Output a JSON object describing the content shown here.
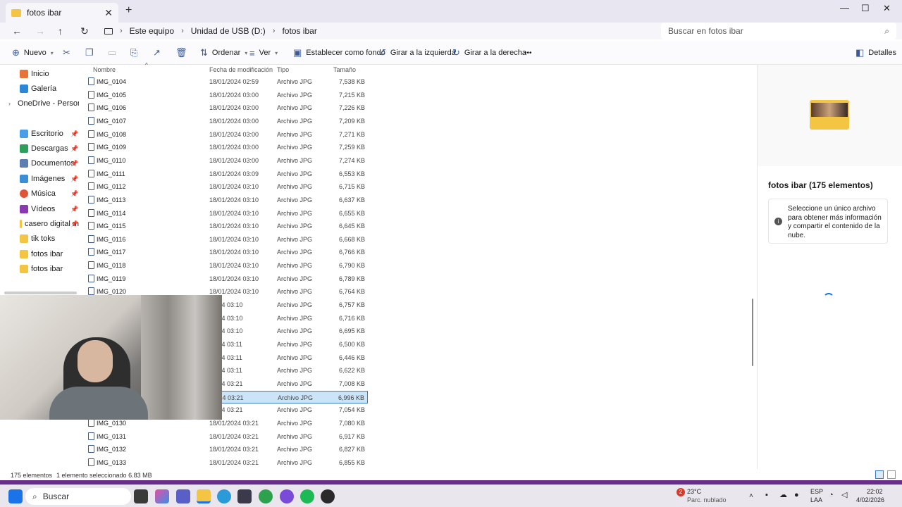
{
  "window": {
    "tab_title": "fotos ibar",
    "close": "✕",
    "new_tab": "+",
    "minimize": "—",
    "maximize": "☐",
    "close_window": "✕"
  },
  "address": {
    "breadcrumb": [
      "Este equipo",
      "Unidad de USB (D:)",
      "fotos ibar"
    ],
    "search_placeholder": "Buscar en fotos ibar"
  },
  "toolbar": {
    "new": "Nuevo",
    "sort": "Ordenar",
    "view": "Ver",
    "set_background": "Establecer como fondo",
    "rotate_left": "Girar a la izquierda",
    "rotate_right": "Girar a la derecha",
    "more": "•••",
    "details": "Detalles"
  },
  "sidebar": {
    "items": [
      {
        "label": "Inicio",
        "color": "#e8733a"
      },
      {
        "label": "Galería",
        "color": "#2b88d8"
      },
      {
        "label": "OneDrive - Persona",
        "color": "#2b88d8"
      },
      {
        "label": "Escritorio",
        "color": "#4a9ee8"
      },
      {
        "label": "Descargas",
        "color": "#2e9e5b"
      },
      {
        "label": "Documentos",
        "color": "#5a7fb0"
      },
      {
        "label": "Imágenes",
        "color": "#3a8fd8"
      },
      {
        "label": "Música",
        "color": "#e0543a"
      },
      {
        "label": "Vídeos",
        "color": "#8a3ab0"
      },
      {
        "label": "casero digital m",
        "color": "#f4c542"
      },
      {
        "label": "tik toks",
        "color": "#f4c542"
      },
      {
        "label": "fotos ibar",
        "color": "#f4c542"
      },
      {
        "label": "fotos ibar",
        "color": "#f4c542"
      }
    ]
  },
  "columns": {
    "name": "Nombre",
    "date": "Fecha de modificación",
    "type": "Tipo",
    "size": "Tamaño"
  },
  "files": [
    {
      "name": "IMG_0104",
      "date": "18/01/2024 02:59",
      "type": "Archivo JPG",
      "size": "7,538 KB"
    },
    {
      "name": "IMG_0105",
      "date": "18/01/2024 03:00",
      "type": "Archivo JPG",
      "size": "7,215 KB"
    },
    {
      "name": "IMG_0106",
      "date": "18/01/2024 03:00",
      "type": "Archivo JPG",
      "size": "7,226 KB"
    },
    {
      "name": "IMG_0107",
      "date": "18/01/2024 03:00",
      "type": "Archivo JPG",
      "size": "7,209 KB"
    },
    {
      "name": "IMG_0108",
      "date": "18/01/2024 03:00",
      "type": "Archivo JPG",
      "size": "7,271 KB"
    },
    {
      "name": "IMG_0109",
      "date": "18/01/2024 03:00",
      "type": "Archivo JPG",
      "size": "7,259 KB"
    },
    {
      "name": "IMG_0110",
      "date": "18/01/2024 03:00",
      "type": "Archivo JPG",
      "size": "7,274 KB"
    },
    {
      "name": "IMG_0111",
      "date": "18/01/2024 03:09",
      "type": "Archivo JPG",
      "size": "6,553 KB"
    },
    {
      "name": "IMG_0112",
      "date": "18/01/2024 03:10",
      "type": "Archivo JPG",
      "size": "6,715 KB"
    },
    {
      "name": "IMG_0113",
      "date": "18/01/2024 03:10",
      "type": "Archivo JPG",
      "size": "6,637 KB"
    },
    {
      "name": "IMG_0114",
      "date": "18/01/2024 03:10",
      "type": "Archivo JPG",
      "size": "6,655 KB"
    },
    {
      "name": "IMG_0115",
      "date": "18/01/2024 03:10",
      "type": "Archivo JPG",
      "size": "6,645 KB"
    },
    {
      "name": "IMG_0116",
      "date": "18/01/2024 03:10",
      "type": "Archivo JPG",
      "size": "6,668 KB"
    },
    {
      "name": "IMG_0117",
      "date": "18/01/2024 03:10",
      "type": "Archivo JPG",
      "size": "6,766 KB"
    },
    {
      "name": "IMG_0118",
      "date": "18/01/2024 03:10",
      "type": "Archivo JPG",
      "size": "6,790 KB"
    },
    {
      "name": "IMG_0119",
      "date": "18/01/2024 03:10",
      "type": "Archivo JPG",
      "size": "6,789 KB"
    },
    {
      "name": "IMG_0120",
      "date": "18/01/2024 03:10",
      "type": "Archivo JPG",
      "size": "6,764 KB"
    },
    {
      "name": "",
      "date": "/2024 03:10",
      "type": "Archivo JPG",
      "size": "6,757 KB"
    },
    {
      "name": "",
      "date": "/2024 03:10",
      "type": "Archivo JPG",
      "size": "6,716 KB"
    },
    {
      "name": "",
      "date": "/2024 03:10",
      "type": "Archivo JPG",
      "size": "6,695 KB"
    },
    {
      "name": "",
      "date": "/2024 03:11",
      "type": "Archivo JPG",
      "size": "6,500 KB"
    },
    {
      "name": "",
      "date": "/2024 03:11",
      "type": "Archivo JPG",
      "size": "6,446 KB"
    },
    {
      "name": "",
      "date": "/2024 03:11",
      "type": "Archivo JPG",
      "size": "6,622 KB"
    },
    {
      "name": "",
      "date": "/2024 03:21",
      "type": "Archivo JPG",
      "size": "7,008 KB"
    },
    {
      "name": "",
      "date": "/2024 03:21",
      "type": "Archivo JPG",
      "size": "6,996 KB",
      "selected": true
    },
    {
      "name": "",
      "date": "/2024 03:21",
      "type": "Archivo JPG",
      "size": "7,054 KB"
    },
    {
      "name": "IMG_0130",
      "date": "18/01/2024 03:21",
      "type": "Archivo JPG",
      "size": "7,080 KB"
    },
    {
      "name": "IMG_0131",
      "date": "18/01/2024 03:21",
      "type": "Archivo JPG",
      "size": "6,917 KB"
    },
    {
      "name": "IMG_0132",
      "date": "18/01/2024 03:21",
      "type": "Archivo JPG",
      "size": "6,827 KB"
    },
    {
      "name": "IMG_0133",
      "date": "18/01/2024 03:21",
      "type": "Archivo JPG",
      "size": "6,855 KB"
    }
  ],
  "details": {
    "title": "fotos ibar (175 elementos)",
    "info": "Seleccione un único archivo para obtener más información y compartir el contenido de la nube."
  },
  "status": {
    "count": "175 elementos",
    "selection": "1 elemento seleccionado  6.83 MB"
  },
  "taskbar": {
    "search": "Buscar",
    "weather_temp": "23°C",
    "weather_desc": "Parc. nublado",
    "weather_badge": "2",
    "lang1": "ESP",
    "lang2": "LAA",
    "time": "22:02",
    "date": "4/02/2026"
  }
}
